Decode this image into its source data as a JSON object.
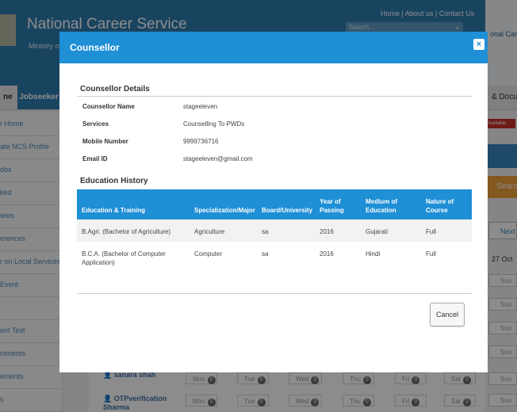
{
  "header": {
    "title": "National Career Service",
    "ministry": "Ministry of",
    "toplinks": "Home | About us | Contact Us",
    "search_placeholder": "Search...",
    "right_logo_text": "onal Car"
  },
  "nav": {
    "home": "ne",
    "jobseeker": "Jobseeker",
    "documents": "& Docu"
  },
  "sidebar": {
    "items": [
      "r Home",
      "ate NCS Profile",
      "obs",
      "ked",
      "iews",
      "erences",
      "r on Local Services",
      "Event",
      "",
      "ent Test",
      "ntments",
      "ements",
      "s"
    ]
  },
  "right_panel": {
    "badge": "Available",
    "search": "Searc",
    "next": "Next",
    "date": "27 Oct",
    "sun": "Sun"
  },
  "background_table": {
    "rows": [
      "sanara shah",
      "OTPverification Sharma"
    ],
    "days": [
      "Mon",
      "Tue",
      "Wed",
      "Thu",
      "Fri",
      "Sat"
    ],
    "count": "0"
  },
  "modal": {
    "title": "Counsellor",
    "close": "×",
    "details_heading": "Counsellor Details",
    "details": [
      {
        "label": "Counsellor Name",
        "value": "stageeleven"
      },
      {
        "label": "Services",
        "value": "Counselling To PWDs"
      },
      {
        "label": "Mobile Number",
        "value": "9999736716"
      },
      {
        "label": "Email ID",
        "value": "stageeleven@gmail.com"
      }
    ],
    "education_heading": "Education History",
    "columns": [
      "Education & Training",
      "Specialization/Major",
      "Board/University",
      "Year of Passing",
      "Medium of Education",
      "Nature of Course"
    ],
    "rows": [
      {
        "education": "B.Agri. (Bachelor of Agriculture)",
        "specialization": "Agriculture",
        "board": "sa",
        "year": "2016",
        "medium": "Gujarati",
        "nature": "Full"
      },
      {
        "education": "B.C.A. (Bachelor of Computer Application)",
        "specialization": "Computer",
        "board": "sa",
        "year": "2016",
        "medium": "Hindi",
        "nature": "Full"
      }
    ],
    "cancel": "Cancel"
  }
}
